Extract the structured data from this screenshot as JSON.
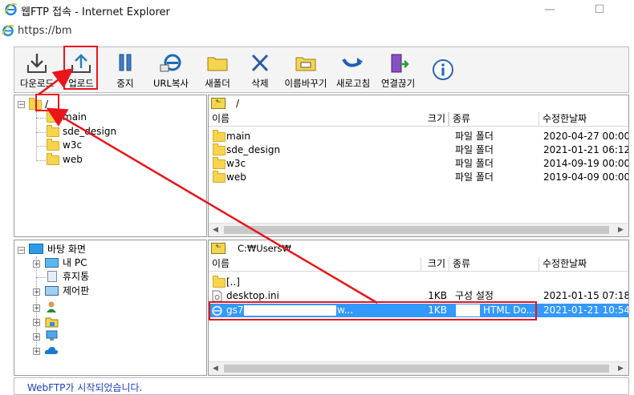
{
  "window": {
    "title": "웹FTP 접속 - Internet Explorer",
    "minimize": "—",
    "maximize": "☐",
    "close": "✕"
  },
  "address": {
    "url": "https://bm"
  },
  "toolbar": {
    "download": "다운로드",
    "upload": "업로드",
    "stop": "중지",
    "url_copy": "URL복사",
    "new_folder": "새폴더",
    "delete": "삭제",
    "rename": "이름바꾸기",
    "refresh": "새로고침",
    "disconnect": "연결끊기"
  },
  "remote": {
    "tree": {
      "root": "/",
      "items": [
        "main",
        "sde_design",
        "w3c",
        "web"
      ]
    },
    "path": "/",
    "columns": {
      "name": "이름",
      "size": "크기",
      "type": "종류",
      "modified": "수정한날짜"
    },
    "rows": [
      {
        "name": "main",
        "type": "파일 폴더",
        "modified": "2020-04-27 00:00:0"
      },
      {
        "name": "sde_design",
        "type": "파일 폴더",
        "modified": "2021-01-21 06:12:0"
      },
      {
        "name": "w3c",
        "type": "파일 폴더",
        "modified": "2014-09-19 00:00:0"
      },
      {
        "name": "web",
        "type": "파일 폴더",
        "modified": "2019-04-09 00:00:0"
      }
    ]
  },
  "local": {
    "tree": {
      "desktop": "바탕 화면",
      "items": [
        "내 PC",
        "휴지통",
        "제어판"
      ]
    },
    "path": "C:₩Users₩",
    "columns": {
      "name": "이름",
      "size": "크기",
      "type": "종류",
      "modified": "수정한날짜"
    },
    "rows": [
      {
        "name": "[..]",
        "size": "",
        "type": "",
        "modified": ""
      },
      {
        "name": "desktop.ini",
        "size": "1KB",
        "type": "구성 설정",
        "modified": "2021-01-15 07:18"
      },
      {
        "name": "gs7",
        "name_tail": "w...",
        "size": "1KB",
        "type": "HTML Do...",
        "modified": "2021-01-21 10:54"
      }
    ]
  },
  "status": {
    "message": "WebFTP가 시작되었습니다."
  },
  "colors": {
    "annotation": "#e8151b",
    "selection": "#3399ff",
    "status_text": "#1f3fbf",
    "folder": "#f6d54e"
  }
}
